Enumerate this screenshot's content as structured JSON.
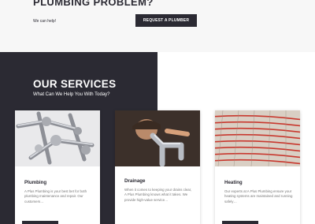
{
  "hero": {
    "title": "PLUMBING PROBLEM?",
    "subtitle": "We can help!",
    "cta_label": "REQUEST A PLUMBER"
  },
  "services": {
    "title": "OUR SERVICES",
    "subtitle": "What Can We Help You With Today?",
    "cards": [
      {
        "title": "Plumbing",
        "text": "A Plus Plumbing is your best bet for both plumbing maintenance and repair. Our customers…",
        "image": "chrome-pipe-fittings-photo"
      },
      {
        "title": "Drainage",
        "text": "When it comes to keeping your drains clear, A Plus Plumbing knows what it takes. We provide high-value service…",
        "image": "plumber-under-sink-photo"
      },
      {
        "title": "Heating",
        "text": "Our experts at A Plus Plumbing ensure your heating systems are maintained and running safely…",
        "image": "underfloor-heating-pipes-photo"
      }
    ]
  },
  "colors": {
    "dark": "#2b2a33",
    "light_bg": "#f7f7f7",
    "heating_pipe": "#c8382e"
  }
}
